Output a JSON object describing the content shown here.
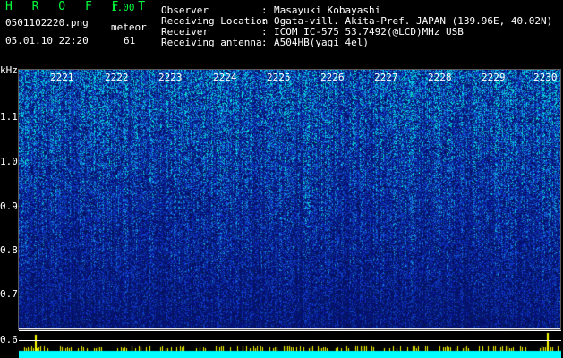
{
  "header": {
    "app_name": "H R O F F T",
    "version": "1.00",
    "filename": "0501102220.png",
    "datetime": "05.01.10 22:20",
    "meteor_label": "meteor",
    "meteor_count": "61",
    "fields": [
      {
        "label": "Observer",
        "sep": ":",
        "value": "Masayuki Kobayashi"
      },
      {
        "label": "Receiving Location",
        "sep": ":",
        "value": "Ogata-vill. Akita-Pref. JAPAN (139.96E, 40.02N)"
      },
      {
        "label": "Receiver",
        "sep": ":",
        "value": "ICOM IC-575 53.7492(@LCD)MHz USB"
      },
      {
        "label": "Receiving antenna",
        "sep": ":",
        "value": "A504HB(yagi 4el)"
      }
    ]
  },
  "axis": {
    "y_unit": "kHz",
    "y_ticks": [
      "1.1",
      "1.0",
      "0.9",
      "0.8",
      "0.7",
      "0.6"
    ],
    "time_ticks": [
      "2221",
      "2222",
      "2223",
      "2224",
      "2225",
      "2226",
      "2227",
      "2228",
      "2229",
      "2230"
    ]
  },
  "colors": {
    "background": "#000000",
    "header_green": "#00ff3c",
    "header_white": "#ffffff",
    "spectrogram_base": "#0a1a8a",
    "spectrogram_noise": "#00ccff",
    "strip": "#00ffff",
    "strip_spikes": "#ffff00"
  }
}
